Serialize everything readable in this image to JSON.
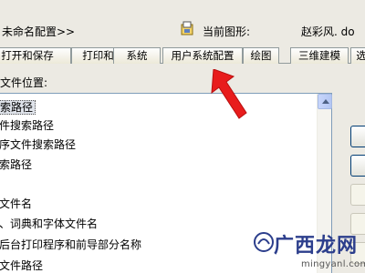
{
  "header": {
    "profile_label": "未命名配置>>",
    "drawing_label": "当前图形:",
    "drawing_value": "赵彩风. do"
  },
  "tabs": [
    {
      "label": "打开和保存",
      "active": false
    },
    {
      "label": "打印和发布",
      "active": false
    },
    {
      "label": "系统",
      "active": false
    },
    {
      "label": "用户系统配置",
      "active": false
    },
    {
      "label": "绘图",
      "active": false
    },
    {
      "label": "三维建模",
      "active": false
    },
    {
      "label": "选",
      "active": false
    }
  ],
  "section_label": "文件位置:",
  "tree": [
    {
      "label": "索路径",
      "selected": true
    },
    {
      "label": "件搜索路径",
      "selected": false
    },
    {
      "label": "序文件搜索路径",
      "selected": false
    },
    {
      "label": "索路径",
      "selected": false
    },
    {
      "label": "",
      "selected": false
    },
    {
      "label": "文件名",
      "selected": false
    },
    {
      "label": "、词典和字体文件名",
      "selected": false
    },
    {
      "label": "后台打印程序和前导部分名称",
      "selected": false
    },
    {
      "label": "文件路径",
      "selected": false
    }
  ],
  "watermark": {
    "text": "广西龙网",
    "url": "mingyanl.com"
  },
  "icons": {
    "drawing": "drawing-file-icon",
    "arrow": "red-arrow-annotation",
    "scroll_up": "scroll-up-arrow-icon"
  },
  "colors": {
    "window_bg": "#eceae3",
    "active_tab_accent": "#e7a23c",
    "selection_bg": "#dfe3ea",
    "arrow": "#e81c1c",
    "watermark": "#2c3e8c"
  }
}
